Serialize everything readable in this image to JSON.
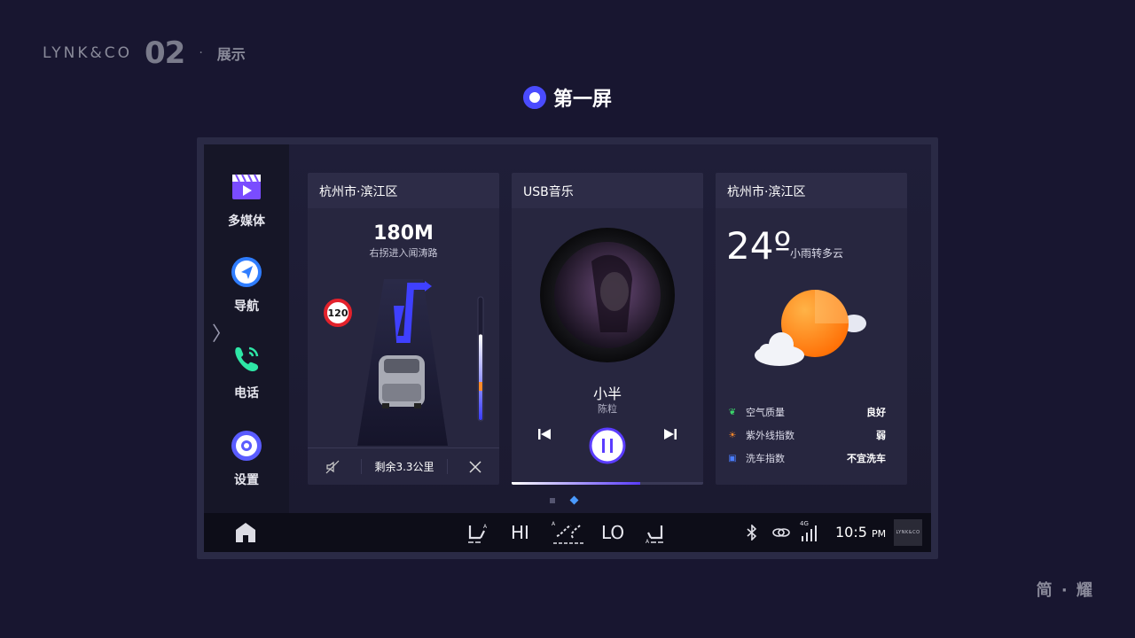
{
  "brand": {
    "logo": "LYNK&CO",
    "number": "02",
    "dot": "·",
    "subtitle": "展示"
  },
  "screen_title": "第一屏",
  "sidebar": {
    "items": [
      {
        "label": "多媒体",
        "icon": "media-icon"
      },
      {
        "label": "导航",
        "icon": "navigation-icon"
      },
      {
        "label": "电话",
        "icon": "phone-icon"
      },
      {
        "label": "设置",
        "icon": "settings-icon"
      }
    ],
    "expand_icon": "chevron-right-icon"
  },
  "nav_card": {
    "location": "杭州市·滨江区",
    "distance": "180M",
    "instruction": "右拐进入闻涛路",
    "speed_limit": "120",
    "remaining": "剩余3.3公里",
    "route_progress": 0.3
  },
  "music_card": {
    "source": "USB音乐",
    "song": "小半",
    "artist": "陈粒",
    "progress": 0.67
  },
  "weather_card": {
    "location": "杭州市·滨江区",
    "temperature": "24º",
    "condition": "小雨转多云",
    "rows": [
      {
        "label": "空气质量",
        "value": "良好",
        "icon": "leaf-icon"
      },
      {
        "label": "紫外线指数",
        "value": "弱",
        "icon": "sun-icon"
      },
      {
        "label": "洗车指数",
        "value": "不宜洗车",
        "icon": "car-icon"
      }
    ]
  },
  "pager": {
    "count": 2,
    "active": 1
  },
  "bottom_bar": {
    "left_temp": "HI",
    "right_temp": "LO",
    "network": "4G",
    "time": "10:5",
    "ampm": "PM",
    "badge": "LYNK&CO"
  },
  "footer_mark": "简 · 耀",
  "colors": {
    "accent": "#4a4bff",
    "background": "#181630",
    "card": "#27263f"
  }
}
